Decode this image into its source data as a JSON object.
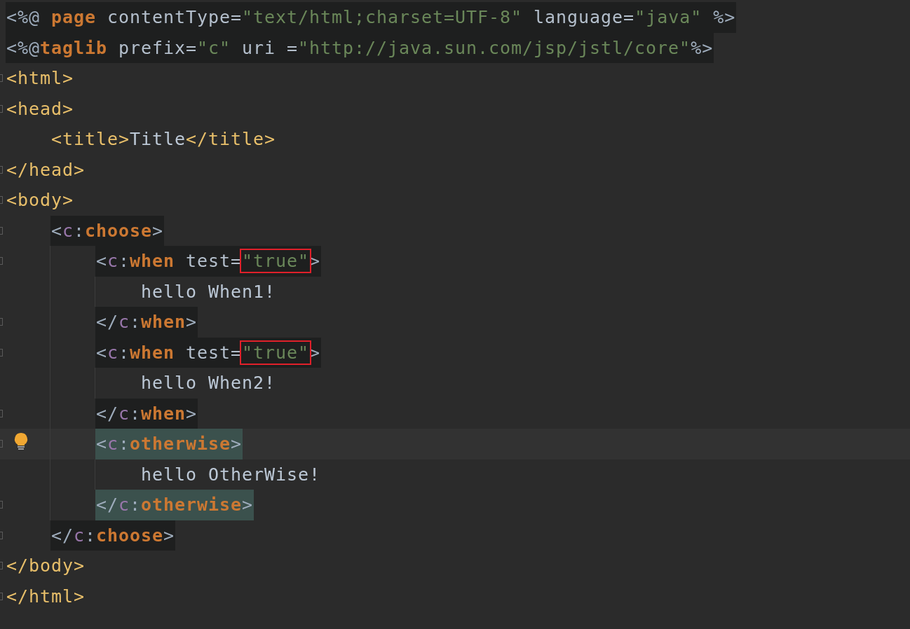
{
  "editor": {
    "lines": [
      {
        "fold": false,
        "bulb": false,
        "current": false,
        "shaded": true,
        "matched": false,
        "tokens": [
          {
            "kind": "punct",
            "text": "<%@ "
          },
          {
            "kind": "keyword",
            "text": "page"
          },
          {
            "kind": "attr",
            "text": " contentType="
          },
          {
            "kind": "string",
            "text": "\"text/html;charset=UTF-8\""
          },
          {
            "kind": "attr",
            "text": " language="
          },
          {
            "kind": "string",
            "text": "\"java\""
          },
          {
            "kind": "punct",
            "text": " %>"
          }
        ]
      },
      {
        "fold": false,
        "bulb": false,
        "current": false,
        "shaded": true,
        "matched": false,
        "tokens": [
          {
            "kind": "punct",
            "text": "<%@"
          },
          {
            "kind": "keyword",
            "text": "taglib"
          },
          {
            "kind": "attr",
            "text": " prefix="
          },
          {
            "kind": "string",
            "text": "\"c\""
          },
          {
            "kind": "attr",
            "text": " uri ="
          },
          {
            "kind": "string",
            "text": "\"http://java.sun.com/jsp/jstl/core\""
          },
          {
            "kind": "punct",
            "text": "%>"
          }
        ]
      },
      {
        "fold": true,
        "bulb": false,
        "current": false,
        "shaded": false,
        "matched": false,
        "tokens": [
          {
            "kind": "tag",
            "text": "<html>"
          }
        ]
      },
      {
        "fold": true,
        "bulb": false,
        "current": false,
        "shaded": false,
        "matched": false,
        "tokens": [
          {
            "kind": "tag",
            "text": "<head>"
          }
        ],
        "children": [
          {
            "fold": false,
            "bulb": false,
            "current": false,
            "shaded": false,
            "matched": false,
            "tokens": [
              {
                "kind": "tag",
                "text": "<title>"
              },
              {
                "kind": "text",
                "text": "Title"
              },
              {
                "kind": "tag",
                "text": "</title>"
              }
            ]
          }
        ]
      },
      {
        "fold": true,
        "bulb": false,
        "current": false,
        "shaded": false,
        "matched": false,
        "tokens": [
          {
            "kind": "tag",
            "text": "</head>"
          }
        ]
      },
      {
        "fold": true,
        "bulb": false,
        "current": false,
        "shaded": false,
        "matched": false,
        "tokens": [
          {
            "kind": "tag",
            "text": "<body>"
          }
        ],
        "children": [
          {
            "fold": true,
            "bulb": false,
            "current": false,
            "shaded": true,
            "matched": false,
            "tokens": [
              {
                "kind": "punct",
                "text": "<"
              },
              {
                "kind": "prefix",
                "text": "c"
              },
              {
                "kind": "punct",
                "text": ":"
              },
              {
                "kind": "keyword",
                "text": "choose"
              },
              {
                "kind": "punct",
                "text": ">"
              }
            ],
            "children": [
              {
                "fold": true,
                "bulb": false,
                "current": false,
                "shaded": true,
                "matched": false,
                "tokens": [
                  {
                    "kind": "punct",
                    "text": "<"
                  },
                  {
                    "kind": "prefix",
                    "text": "c"
                  },
                  {
                    "kind": "punct",
                    "text": ":"
                  },
                  {
                    "kind": "keyword",
                    "text": "when"
                  },
                  {
                    "kind": "attr",
                    "text": " test="
                  },
                  {
                    "kind": "marked",
                    "text": "\"true\""
                  },
                  {
                    "kind": "punct",
                    "text": ">"
                  }
                ],
                "children": [
                  {
                    "fold": false,
                    "bulb": false,
                    "current": false,
                    "shaded": false,
                    "matched": false,
                    "tokens": [
                      {
                        "kind": "text",
                        "text": "hello When1!"
                      }
                    ]
                  }
                ]
              },
              {
                "fold": true,
                "bulb": false,
                "current": false,
                "shaded": true,
                "matched": false,
                "tokens": [
                  {
                    "kind": "punct",
                    "text": "</"
                  },
                  {
                    "kind": "prefix",
                    "text": "c"
                  },
                  {
                    "kind": "punct",
                    "text": ":"
                  },
                  {
                    "kind": "keyword",
                    "text": "when"
                  },
                  {
                    "kind": "punct",
                    "text": ">"
                  }
                ]
              },
              {
                "fold": true,
                "bulb": false,
                "current": false,
                "shaded": true,
                "matched": false,
                "tokens": [
                  {
                    "kind": "punct",
                    "text": "<"
                  },
                  {
                    "kind": "prefix",
                    "text": "c"
                  },
                  {
                    "kind": "punct",
                    "text": ":"
                  },
                  {
                    "kind": "keyword",
                    "text": "when"
                  },
                  {
                    "kind": "attr",
                    "text": " test="
                  },
                  {
                    "kind": "marked",
                    "text": "\"true\""
                  },
                  {
                    "kind": "punct",
                    "text": ">"
                  }
                ],
                "children": [
                  {
                    "fold": false,
                    "bulb": false,
                    "current": false,
                    "shaded": false,
                    "matched": false,
                    "tokens": [
                      {
                        "kind": "text",
                        "text": "hello When2!"
                      }
                    ]
                  }
                ]
              },
              {
                "fold": true,
                "bulb": false,
                "current": false,
                "shaded": true,
                "matched": false,
                "tokens": [
                  {
                    "kind": "punct",
                    "text": "</"
                  },
                  {
                    "kind": "prefix",
                    "text": "c"
                  },
                  {
                    "kind": "punct",
                    "text": ":"
                  },
                  {
                    "kind": "keyword",
                    "text": "when"
                  },
                  {
                    "kind": "punct",
                    "text": ">"
                  }
                ]
              },
              {
                "fold": true,
                "bulb": true,
                "current": true,
                "shaded": false,
                "matched": true,
                "tokens": [
                  {
                    "kind": "punct",
                    "text": "<"
                  },
                  {
                    "kind": "prefix",
                    "text": "c"
                  },
                  {
                    "kind": "punct",
                    "text": ":"
                  },
                  {
                    "kind": "keyword",
                    "text": "otherwise"
                  },
                  {
                    "kind": "punct",
                    "text": ">"
                  }
                ],
                "children": [
                  {
                    "fold": false,
                    "bulb": false,
                    "current": false,
                    "shaded": false,
                    "matched": false,
                    "tokens": [
                      {
                        "kind": "text",
                        "text": "hello OtherWise!"
                      }
                    ]
                  }
                ]
              },
              {
                "fold": true,
                "bulb": false,
                "current": false,
                "shaded": false,
                "matched": true,
                "tokens": [
                  {
                    "kind": "punct",
                    "text": "</"
                  },
                  {
                    "kind": "prefix",
                    "text": "c"
                  },
                  {
                    "kind": "punct",
                    "text": ":"
                  },
                  {
                    "kind": "keyword",
                    "text": "otherwise"
                  },
                  {
                    "kind": "punct",
                    "text": ">"
                  }
                ]
              }
            ]
          },
          {
            "fold": true,
            "bulb": false,
            "current": false,
            "shaded": true,
            "matched": false,
            "tokens": [
              {
                "kind": "punct",
                "text": "</"
              },
              {
                "kind": "prefix",
                "text": "c"
              },
              {
                "kind": "punct",
                "text": ":"
              },
              {
                "kind": "keyword",
                "text": "choose"
              },
              {
                "kind": "punct",
                "text": ">"
              }
            ]
          }
        ]
      },
      {
        "fold": true,
        "bulb": false,
        "current": false,
        "shaded": false,
        "matched": false,
        "tokens": [
          {
            "kind": "tag",
            "text": "</body>"
          }
        ]
      },
      {
        "fold": true,
        "bulb": false,
        "current": false,
        "shaded": false,
        "matched": false,
        "tokens": [
          {
            "kind": "tag",
            "text": "</html>"
          }
        ]
      }
    ]
  }
}
